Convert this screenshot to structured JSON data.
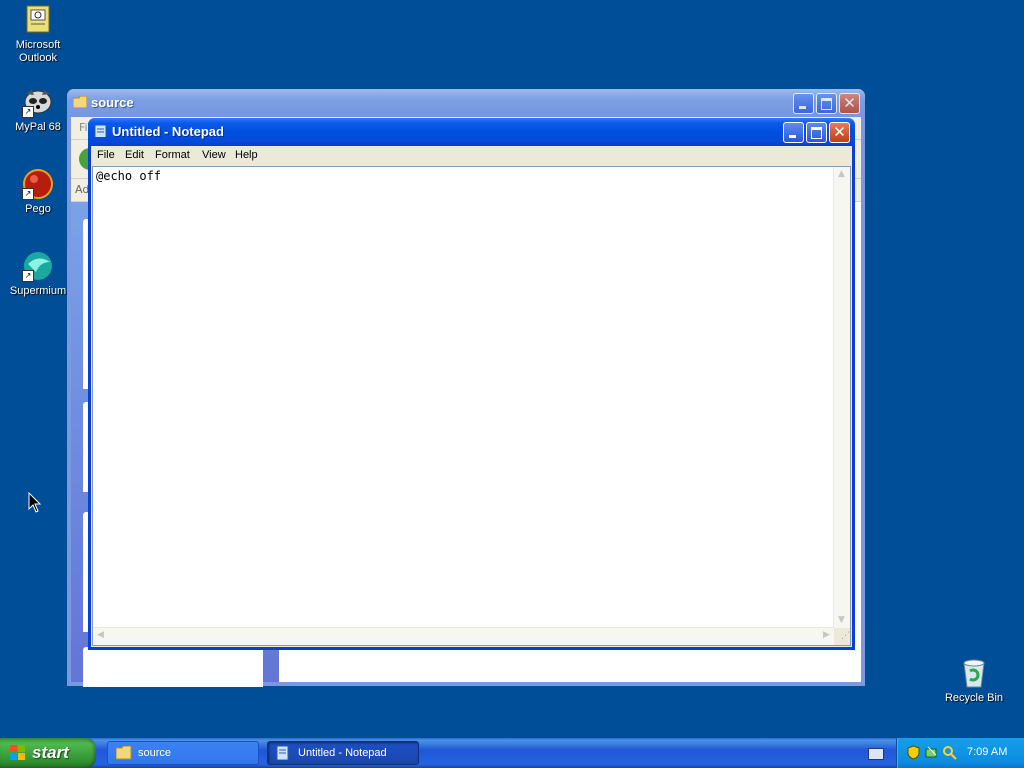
{
  "desktop": {
    "icons": [
      {
        "label": "Microsoft Outlook",
        "icon": "outlook-icon"
      },
      {
        "label": "MyPal 68",
        "icon": "mypal-icon"
      },
      {
        "label": "Pego",
        "icon": "pego-icon"
      },
      {
        "label": "Supermium",
        "icon": "supermium-icon"
      }
    ],
    "recycle_bin": {
      "label": "Recycle Bin",
      "icon": "recycle-bin-icon"
    }
  },
  "explorer_window": {
    "title": "source",
    "menu_partial": "Fi",
    "address_partial": "Ad"
  },
  "notepad": {
    "title": "Untitled - Notepad",
    "menu": [
      "File",
      "Edit",
      "Format",
      "View",
      "Help"
    ],
    "content": "@echo off"
  },
  "taskbar": {
    "start_label": "start",
    "tasks": [
      {
        "label": "source",
        "icon": "folder-icon",
        "active": false
      },
      {
        "label": "Untitled - Notepad",
        "icon": "notepad-icon",
        "active": true
      }
    ],
    "clock": "7:09 AM"
  },
  "colors": {
    "desktop": "#004e98",
    "active_title": "#0050e0",
    "start_green": "#3c9a3c",
    "tray": "#0c8ce0"
  }
}
